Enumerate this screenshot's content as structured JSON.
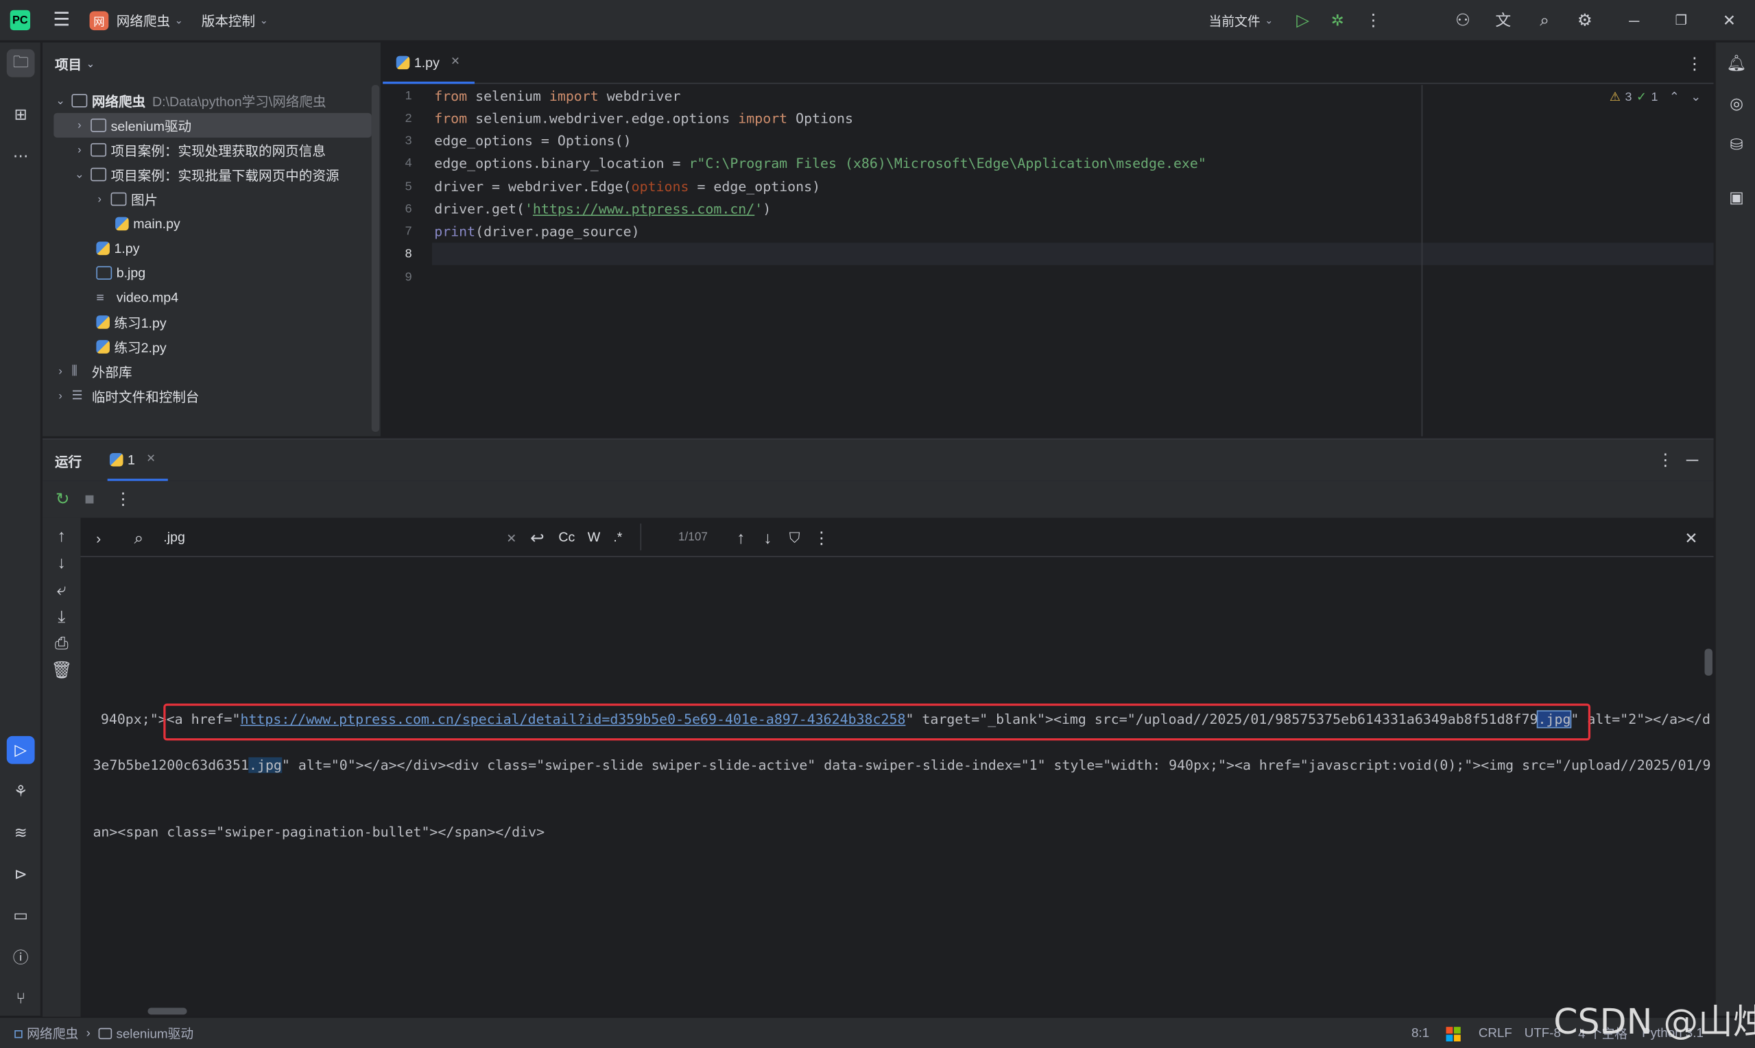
{
  "titlebar": {
    "project_name": "网络爬虫",
    "project_badge": "网",
    "vcs_label": "版本控制",
    "run_config": "当前文件"
  },
  "project_pane": {
    "title": "项目",
    "root": {
      "label": "网络爬虫",
      "path": "D:\\Data\\python学习\\网络爬虫"
    },
    "items": [
      {
        "label": "selenium驱动"
      },
      {
        "label": "项目案例：实现处理获取的网页信息"
      },
      {
        "label": "项目案例：实现批量下载网页中的资源"
      },
      {
        "label": "图片"
      },
      {
        "label": "main.py"
      },
      {
        "label": "1.py"
      },
      {
        "label": "b.jpg"
      },
      {
        "label": "video.mp4"
      },
      {
        "label": "练习1.py"
      },
      {
        "label": "练习2.py"
      },
      {
        "label": "外部库"
      },
      {
        "label": "临时文件和控制台"
      }
    ]
  },
  "editor": {
    "tab_label": "1.py",
    "inspection": {
      "warnings": "3",
      "ok": "1"
    },
    "line_numbers": [
      "1",
      "2",
      "3",
      "4",
      "5",
      "6",
      "7",
      "8",
      "9"
    ],
    "code": {
      "l1": {
        "a": "from",
        "b": " selenium ",
        "c": "import",
        "d": " webdriver"
      },
      "l2": {
        "a": "from",
        "b": " selenium.webdriver.edge.options ",
        "c": "import",
        "d": " Options"
      },
      "l3": "edge_options = Options()",
      "l4": {
        "a": "edge_options.binary_location = ",
        "b": "r\"C:\\Program Files (x86)\\Microsoft\\Edge\\Application\\msedge.exe\""
      },
      "l5": {
        "a": "driver = webdriver.Edge(",
        "b": "options",
        "c": " = edge_options)"
      },
      "l6": {
        "a": "driver.get(",
        "b": "'",
        "c": "https://www.ptpress.com.cn/",
        "d": "'",
        "e": ")"
      },
      "l7": {
        "a": "print",
        "b": "(driver.page_source)"
      }
    }
  },
  "run_panel": {
    "title": "运行",
    "tab_label": "1",
    "find": {
      "query": ".jpg",
      "match_case": "Cc",
      "words": "W",
      "regex": ".*",
      "counter": "1/107"
    },
    "console": {
      "line1": {
        "a": "940px;\">",
        "b": "<a href=\"",
        "url": "https://www.ptpress.com.cn/special/detail?id=d359b5e0-5e69-401e-a897-43624b38c258",
        "c": "\" target=\"_blank\"><img src=\"/upload//2025/01/98575375eb614331a6349ab8f51d8f79",
        "match": ".jpg",
        "d": "\" alt=\"2\"></a></d"
      },
      "line2": {
        "a": "3e7b5be1200c63d6351",
        "match": ".jpg",
        "b": "\" alt=\"0\"></a></div><div class=\"swiper-slide swiper-slide-active\" data-swiper-slide-index=\"1\" style=\"width: 940px;\"><a href=\"javascript:void(0);\"><img src=\"/upload//2025/01/9"
      },
      "line3": "an><span class=\"swiper-pagination-bullet\"></span></div>"
    }
  },
  "statusbar": {
    "crumb_project": "网络爬虫",
    "crumb_folder": "selenium驱动",
    "position": "8:1",
    "line_sep": "CRLF",
    "encoding": "UTF-8",
    "indent": "4 个空格",
    "interpreter": "Python 3.1"
  },
  "watermark": "CSDN @山烛",
  "colors": {
    "accent": "#3574f0",
    "highlight_box": "#e5323b",
    "keyword": "#cf8e6d",
    "string": "#6aab73"
  }
}
